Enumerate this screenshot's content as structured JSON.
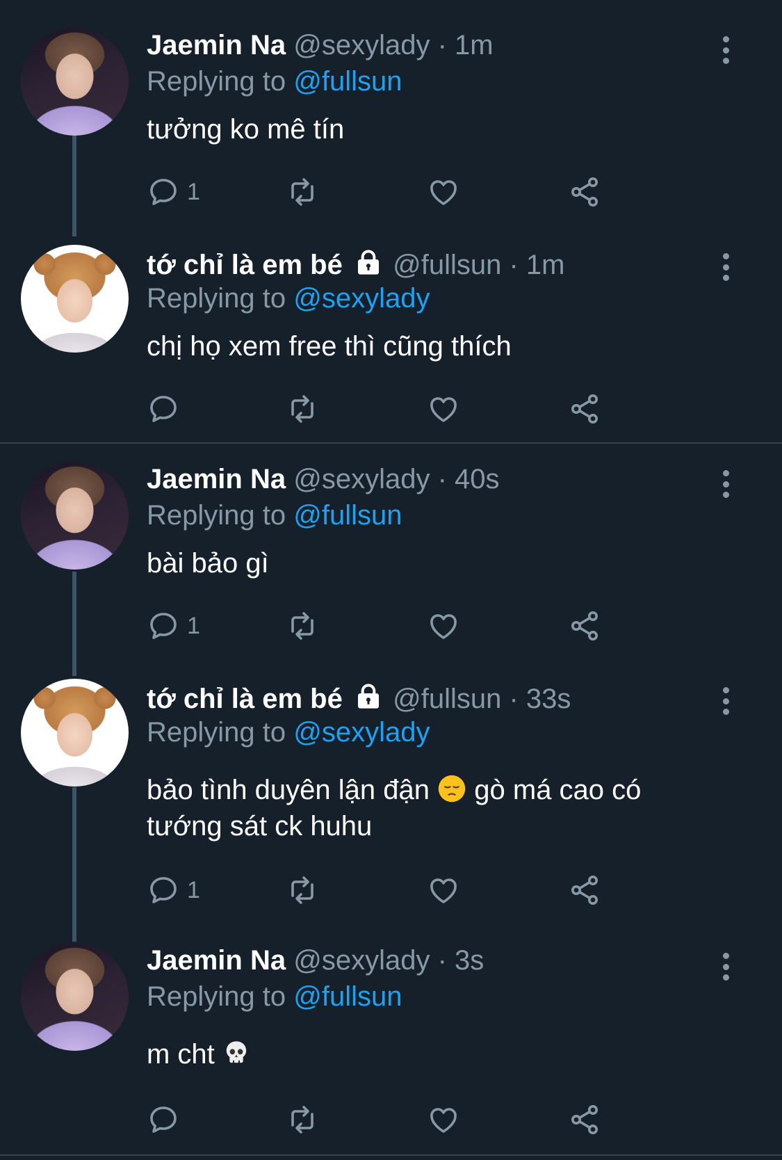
{
  "colors": {
    "background": "#15202b",
    "muted": "#8899a6",
    "link": "#1da1f2",
    "thread_line": "#3d5466",
    "divider": "#38444d"
  },
  "replying_prefix": "Replying to",
  "tweets": [
    {
      "name": "Jaemin Na",
      "handle": "@sexylady",
      "time": "1m",
      "reply_to": "@fullsun",
      "text": "tưởng ko mê tín",
      "reply_count": "1",
      "locked": false
    },
    {
      "name": "tớ chỉ là em bé",
      "handle": "@fullsun",
      "time": "1m",
      "reply_to": "@sexylady",
      "text": "chị họ xem free thì cũng thích",
      "reply_count": "",
      "locked": true
    },
    {
      "name": "Jaemin Na",
      "handle": "@sexylady",
      "time": "40s",
      "reply_to": "@fullsun",
      "text": "bài bảo gì",
      "reply_count": "1",
      "locked": false
    },
    {
      "name": "tớ chỉ là em bé",
      "handle": "@fullsun",
      "time": "33s",
      "reply_to": "@sexylady",
      "text_before_emoji": "bảo tình duyên lận đận",
      "emoji": "pensive-face",
      "text_after_emoji": "gò má cao có tướng sát ck huhu",
      "reply_count": "1",
      "locked": true
    },
    {
      "name": "Jaemin Na",
      "handle": "@sexylady",
      "time": "3s",
      "reply_to": "@fullsun",
      "text": "m cht",
      "emoji": "skull",
      "reply_count": "",
      "locked": false
    }
  ],
  "icons": {
    "reply": "reply-icon",
    "retweet": "retweet-icon",
    "like": "heart-icon",
    "share": "share-icon",
    "more": "more-vertical-icon",
    "lock": "lock-icon"
  }
}
